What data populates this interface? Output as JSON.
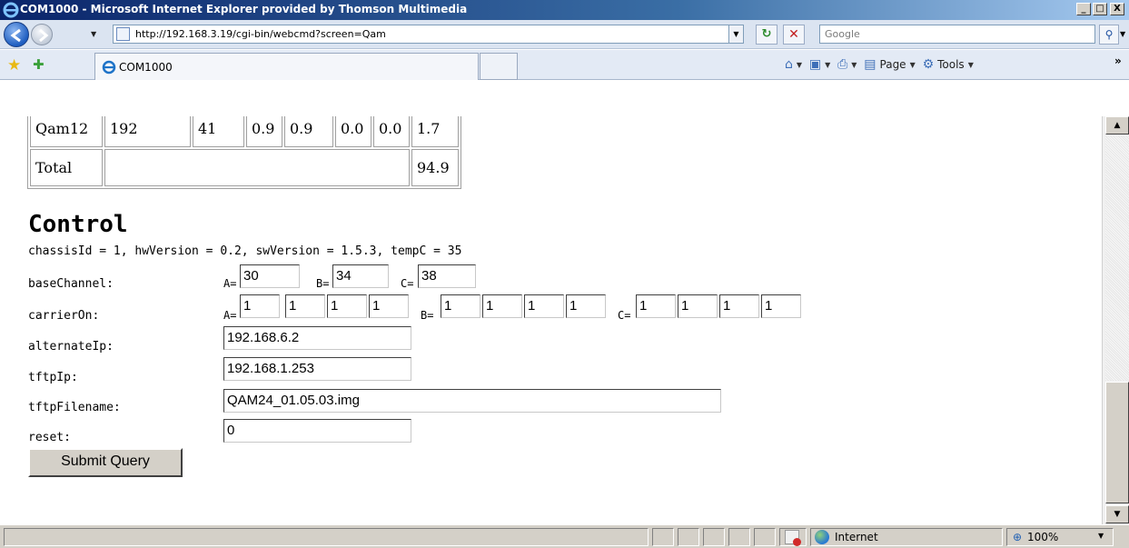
{
  "window": {
    "title": "COM1000 - Microsoft Internet Explorer provided by Thomson Multimedia",
    "minimize": "_",
    "maximize": "□",
    "close": "X"
  },
  "address_bar": {
    "url": "http://192.168.3.19/cgi-bin/webcmd?screen=Qam",
    "search_placeholder": "Google"
  },
  "tab": {
    "label": "COM1000"
  },
  "command_bar": {
    "page_label": "Page",
    "tools_label": "Tools"
  },
  "qam_table": {
    "row": [
      "Qam12",
      "192",
      "41",
      "0.9",
      "0.9",
      "0.0",
      "0.0",
      "1.7"
    ],
    "total_label": "Total",
    "total_value": "94.9"
  },
  "control": {
    "heading": "Control",
    "info": "chassisId = 1, hwVersion = 0.2, swVersion = 1.5.3, tempC = 35",
    "base_channel": {
      "label": "baseChannel:",
      "a_prefix": "A=",
      "a": "30",
      "b_prefix": "B=",
      "b": "34",
      "c_prefix": "C=",
      "c": "38"
    },
    "carrier_on": {
      "label": "carrierOn:",
      "a_prefix": "A=",
      "a": [
        "1",
        "1",
        "1",
        "1"
      ],
      "b_prefix": "B=",
      "b": [
        "1",
        "1",
        "1",
        "1"
      ],
      "c_prefix": "C=",
      "c": [
        "1",
        "1",
        "1",
        "1"
      ]
    },
    "alternate_ip": {
      "label": "alternateIp:",
      "value": "192.168.6.2"
    },
    "tftp_ip": {
      "label": "tftpIp:",
      "value": "192.168.1.253"
    },
    "tftp_filename": {
      "label": "tftpFilename:",
      "value": "QAM24_01.05.03.img"
    },
    "reset": {
      "label": "reset:",
      "value": "0"
    },
    "submit_label": "Submit Query"
  },
  "status_bar": {
    "zone": "Internet",
    "zoom": "100%"
  }
}
